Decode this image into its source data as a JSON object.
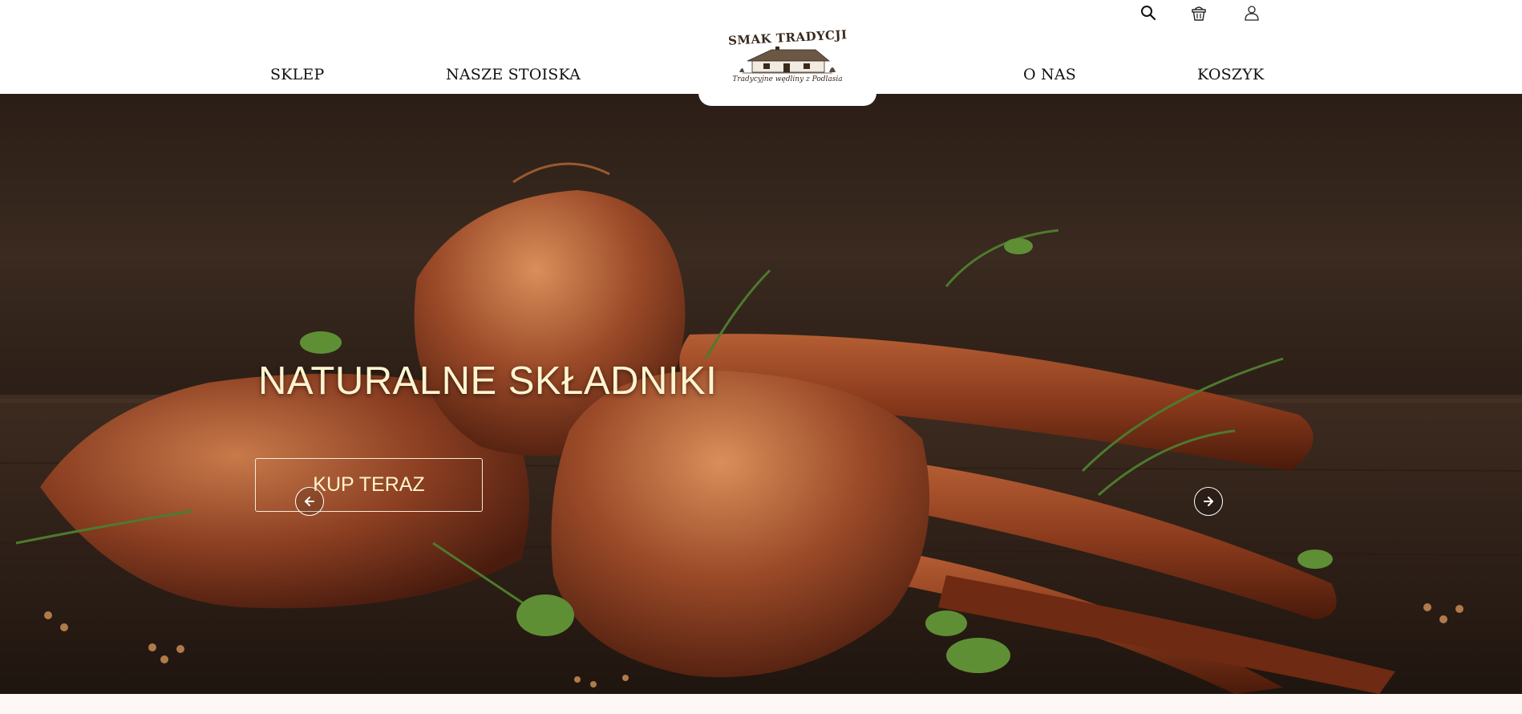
{
  "nav": {
    "left": [
      "SKLEP",
      "NASZE STOISKA"
    ],
    "right": [
      "O NAS",
      "KOSZYK"
    ]
  },
  "icons": {
    "search": "search-icon",
    "basket": "basket-icon",
    "user": "user-icon"
  },
  "logo": {
    "title": "SMAK TRADYCJI",
    "tagline": "Tradycyjne wędliny z Podlasia"
  },
  "hero": {
    "title": "NATURALNE SKŁADNIKI",
    "cta": "KUP TERAZ",
    "prev_icon": "arrow-left-icon",
    "next_icon": "arrow-right-icon"
  },
  "colors": {
    "header_bg": "#ffffff",
    "hero_text": "#fff4cf",
    "page_bg": "#fdf8f5"
  }
}
